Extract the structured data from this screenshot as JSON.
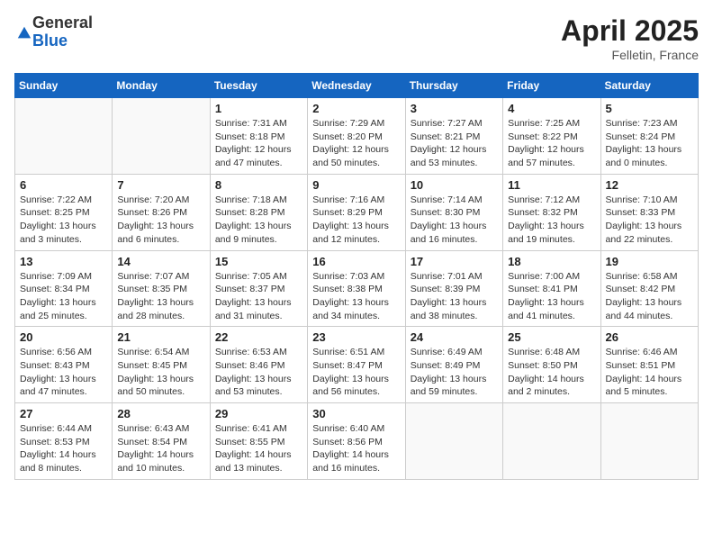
{
  "header": {
    "logo_general": "General",
    "logo_blue": "Blue",
    "month_title": "April 2025",
    "location": "Felletin, France"
  },
  "days_of_week": [
    "Sunday",
    "Monday",
    "Tuesday",
    "Wednesday",
    "Thursday",
    "Friday",
    "Saturday"
  ],
  "weeks": [
    [
      {
        "day": "",
        "info": ""
      },
      {
        "day": "",
        "info": ""
      },
      {
        "day": "1",
        "info": "Sunrise: 7:31 AM\nSunset: 8:18 PM\nDaylight: 12 hours\nand 47 minutes."
      },
      {
        "day": "2",
        "info": "Sunrise: 7:29 AM\nSunset: 8:20 PM\nDaylight: 12 hours\nand 50 minutes."
      },
      {
        "day": "3",
        "info": "Sunrise: 7:27 AM\nSunset: 8:21 PM\nDaylight: 12 hours\nand 53 minutes."
      },
      {
        "day": "4",
        "info": "Sunrise: 7:25 AM\nSunset: 8:22 PM\nDaylight: 12 hours\nand 57 minutes."
      },
      {
        "day": "5",
        "info": "Sunrise: 7:23 AM\nSunset: 8:24 PM\nDaylight: 13 hours\nand 0 minutes."
      }
    ],
    [
      {
        "day": "6",
        "info": "Sunrise: 7:22 AM\nSunset: 8:25 PM\nDaylight: 13 hours\nand 3 minutes."
      },
      {
        "day": "7",
        "info": "Sunrise: 7:20 AM\nSunset: 8:26 PM\nDaylight: 13 hours\nand 6 minutes."
      },
      {
        "day": "8",
        "info": "Sunrise: 7:18 AM\nSunset: 8:28 PM\nDaylight: 13 hours\nand 9 minutes."
      },
      {
        "day": "9",
        "info": "Sunrise: 7:16 AM\nSunset: 8:29 PM\nDaylight: 13 hours\nand 12 minutes."
      },
      {
        "day": "10",
        "info": "Sunrise: 7:14 AM\nSunset: 8:30 PM\nDaylight: 13 hours\nand 16 minutes."
      },
      {
        "day": "11",
        "info": "Sunrise: 7:12 AM\nSunset: 8:32 PM\nDaylight: 13 hours\nand 19 minutes."
      },
      {
        "day": "12",
        "info": "Sunrise: 7:10 AM\nSunset: 8:33 PM\nDaylight: 13 hours\nand 22 minutes."
      }
    ],
    [
      {
        "day": "13",
        "info": "Sunrise: 7:09 AM\nSunset: 8:34 PM\nDaylight: 13 hours\nand 25 minutes."
      },
      {
        "day": "14",
        "info": "Sunrise: 7:07 AM\nSunset: 8:35 PM\nDaylight: 13 hours\nand 28 minutes."
      },
      {
        "day": "15",
        "info": "Sunrise: 7:05 AM\nSunset: 8:37 PM\nDaylight: 13 hours\nand 31 minutes."
      },
      {
        "day": "16",
        "info": "Sunrise: 7:03 AM\nSunset: 8:38 PM\nDaylight: 13 hours\nand 34 minutes."
      },
      {
        "day": "17",
        "info": "Sunrise: 7:01 AM\nSunset: 8:39 PM\nDaylight: 13 hours\nand 38 minutes."
      },
      {
        "day": "18",
        "info": "Sunrise: 7:00 AM\nSunset: 8:41 PM\nDaylight: 13 hours\nand 41 minutes."
      },
      {
        "day": "19",
        "info": "Sunrise: 6:58 AM\nSunset: 8:42 PM\nDaylight: 13 hours\nand 44 minutes."
      }
    ],
    [
      {
        "day": "20",
        "info": "Sunrise: 6:56 AM\nSunset: 8:43 PM\nDaylight: 13 hours\nand 47 minutes."
      },
      {
        "day": "21",
        "info": "Sunrise: 6:54 AM\nSunset: 8:45 PM\nDaylight: 13 hours\nand 50 minutes."
      },
      {
        "day": "22",
        "info": "Sunrise: 6:53 AM\nSunset: 8:46 PM\nDaylight: 13 hours\nand 53 minutes."
      },
      {
        "day": "23",
        "info": "Sunrise: 6:51 AM\nSunset: 8:47 PM\nDaylight: 13 hours\nand 56 minutes."
      },
      {
        "day": "24",
        "info": "Sunrise: 6:49 AM\nSunset: 8:49 PM\nDaylight: 13 hours\nand 59 minutes."
      },
      {
        "day": "25",
        "info": "Sunrise: 6:48 AM\nSunset: 8:50 PM\nDaylight: 14 hours\nand 2 minutes."
      },
      {
        "day": "26",
        "info": "Sunrise: 6:46 AM\nSunset: 8:51 PM\nDaylight: 14 hours\nand 5 minutes."
      }
    ],
    [
      {
        "day": "27",
        "info": "Sunrise: 6:44 AM\nSunset: 8:53 PM\nDaylight: 14 hours\nand 8 minutes."
      },
      {
        "day": "28",
        "info": "Sunrise: 6:43 AM\nSunset: 8:54 PM\nDaylight: 14 hours\nand 10 minutes."
      },
      {
        "day": "29",
        "info": "Sunrise: 6:41 AM\nSunset: 8:55 PM\nDaylight: 14 hours\nand 13 minutes."
      },
      {
        "day": "30",
        "info": "Sunrise: 6:40 AM\nSunset: 8:56 PM\nDaylight: 14 hours\nand 16 minutes."
      },
      {
        "day": "",
        "info": ""
      },
      {
        "day": "",
        "info": ""
      },
      {
        "day": "",
        "info": ""
      }
    ]
  ]
}
